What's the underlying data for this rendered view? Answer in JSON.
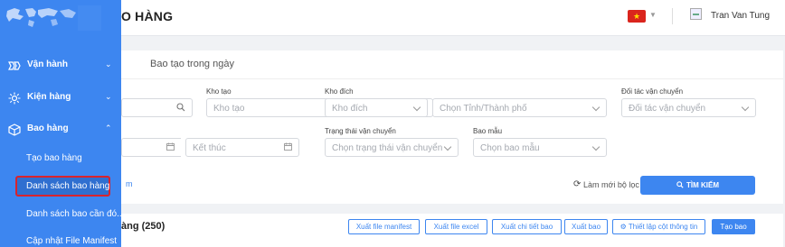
{
  "header": {
    "title": "O HÀNG",
    "user_name": "Tran Van Tung",
    "language_flag_icon": "vietnam-flag-icon"
  },
  "sidebar": {
    "groups": [
      {
        "label": "Vận hành",
        "icon": "operations-icon",
        "chevron": "chevron-down"
      },
      {
        "label": "Kiện hàng",
        "icon": "package-icon",
        "chevron": "chevron-down"
      },
      {
        "label": "Bao hàng",
        "icon": "box-icon",
        "chevron": "chevron-up"
      }
    ],
    "sub_items": [
      {
        "label": "Tạo bao hàng",
        "active": false
      },
      {
        "label": "Danh sách bao hàng",
        "active": true
      },
      {
        "label": "Danh sách bao cần đó...",
        "active": false
      },
      {
        "label": "Cập nhật File Manifest",
        "active": false
      }
    ]
  },
  "tabs": {
    "today": "Bao tạo trong ngày"
  },
  "filters": {
    "kho_tao": {
      "label": "Kho tạo",
      "placeholder": "Kho tạo"
    },
    "kho_dich": {
      "label": "Kho đích",
      "placeholder": "Kho đích"
    },
    "tinh_thanh": {
      "placeholder": "Chọn Tỉnh/Thành phố"
    },
    "doi_tac": {
      "label": "Đối tác vận chuyển",
      "placeholder": "Đối tác vận chuyển"
    },
    "ket_thuc": {
      "placeholder": "Kết thúc"
    },
    "trang_thai": {
      "label": "Trạng thái vận chuyển",
      "placeholder": "Chọn trạng thái vận chuyển"
    },
    "bao_mau": {
      "label": "Bao mẫu",
      "placeholder": "Chọn bao mẫu"
    },
    "more_link": "m",
    "reset_label": "Làm mới bộ lọc",
    "search_label": "TÌM KIẾM"
  },
  "results": {
    "title": "àng (250)",
    "buttons": [
      {
        "label": "Xuất file manifest"
      },
      {
        "label": "Xuất file excel"
      },
      {
        "label": "Xuất chi tiết bao"
      },
      {
        "label": "Xuất bao"
      },
      {
        "label": "Thiết lập cột thông tin"
      },
      {
        "label": "Tạo bao"
      }
    ]
  },
  "colors": {
    "brand": "#3d86f0",
    "active_outline": "#d9232d"
  }
}
